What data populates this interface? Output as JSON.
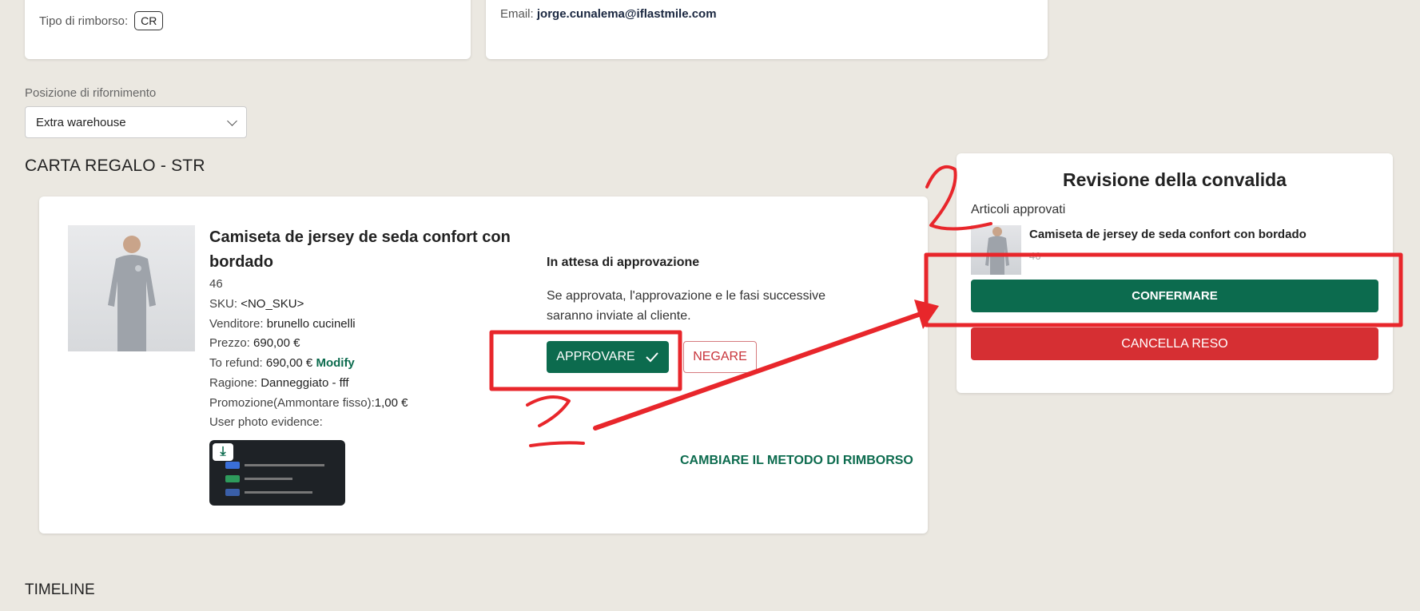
{
  "customer": {
    "refund_type_label": "Tipo di rimborso:",
    "refund_type_value": "CR",
    "email_label": "Email:",
    "email_value": "jorge.cunalema@iflastmile.com"
  },
  "restock": {
    "label": "Posizione di rifornimento",
    "selected": "Extra warehouse"
  },
  "section_title": "CARTA REGALO - STR",
  "product": {
    "name": "Camiseta de jersey de seda confort con bordado",
    "size": "46",
    "sku_label": "SKU:",
    "sku_value": "<NO_SKU>",
    "vendor_label": "Venditore:",
    "vendor_value": "brunello cucinelli",
    "price_label": "Prezzo:",
    "price_value": "690,00 €",
    "refund_label": "To refund:",
    "refund_value": "690,00 €",
    "modify_label": "Modify",
    "reason_label": "Ragione:",
    "reason_value": "Danneggiato - fff",
    "promo_label": "Promozione(Ammontare fisso):",
    "promo_value": "1,00 €",
    "photo_label": "User photo evidence:"
  },
  "approval": {
    "status": "In attesa di approvazione",
    "description": "Se approvata, l'approvazione e le fasi successive saranno inviate al cliente.",
    "approve_label": "APPROVARE",
    "deny_label": "NEGARE",
    "change_method_label": "CAMBIARE IL METODO DI RIMBORSO"
  },
  "review": {
    "title": "Revisione della convalida",
    "approved_label": "Articoli approvati",
    "item_name": "Camiseta de jersey de seda confort con bordado",
    "item_size": "46",
    "confirm_label": "CONFERMARE",
    "cancel_label": "CANCELLA RESO"
  },
  "timeline_title": "TIMELINE",
  "colors": {
    "background": "#ebe8e1",
    "primary_green": "#0c6b4e",
    "danger_red": "#d62f33",
    "annotation_red": "#e8262b"
  }
}
